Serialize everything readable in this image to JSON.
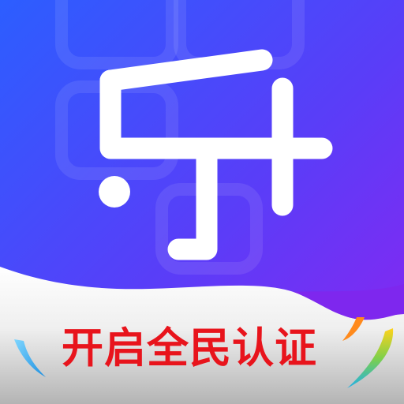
{
  "app_icon": {
    "glyph_name": "le-music-note-logo-icon",
    "banner_text": "开启全民认证",
    "colors": {
      "gradient_start": "#2e5cff",
      "gradient_end": "#8a26f0",
      "glyph": "#ffffff",
      "banner_light": "#f5f5f5",
      "banner_dark": "#b8b8b8",
      "banner_text": "#e8141c",
      "accent_blue": "#27b0ee",
      "accent_orange": "#ff8a1c",
      "accent_yellow": "#ffd21c"
    }
  }
}
